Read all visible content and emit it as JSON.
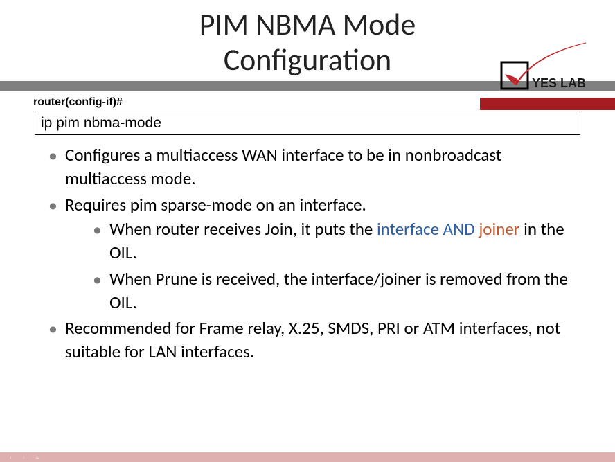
{
  "title_line1": "PIM NBMA Mode",
  "title_line2": "Configuration",
  "logo_text": "YES LAB",
  "prompt": "router(config-if)#",
  "command": "ip pim nbma-mode",
  "bullets": [
    {
      "text": "Configures a multiaccess WAN interface to be in nonbroadcast multiaccess mode."
    },
    {
      "text": "Requires pim sparse-mode on an interface.",
      "sub": [
        {
          "pre": "When router receives Join, it puts the ",
          "hl_blue": "interface AND ",
          "hl_orange": "joiner",
          "post": " in the OIL."
        },
        {
          "plain": "When Prune is received, the interface/joiner is removed from the OIL."
        }
      ]
    },
    {
      "text": "Recommended for Frame relay, X.25, SMDS, PRI or ATM interfaces, not suitable for LAN interfaces."
    }
  ]
}
